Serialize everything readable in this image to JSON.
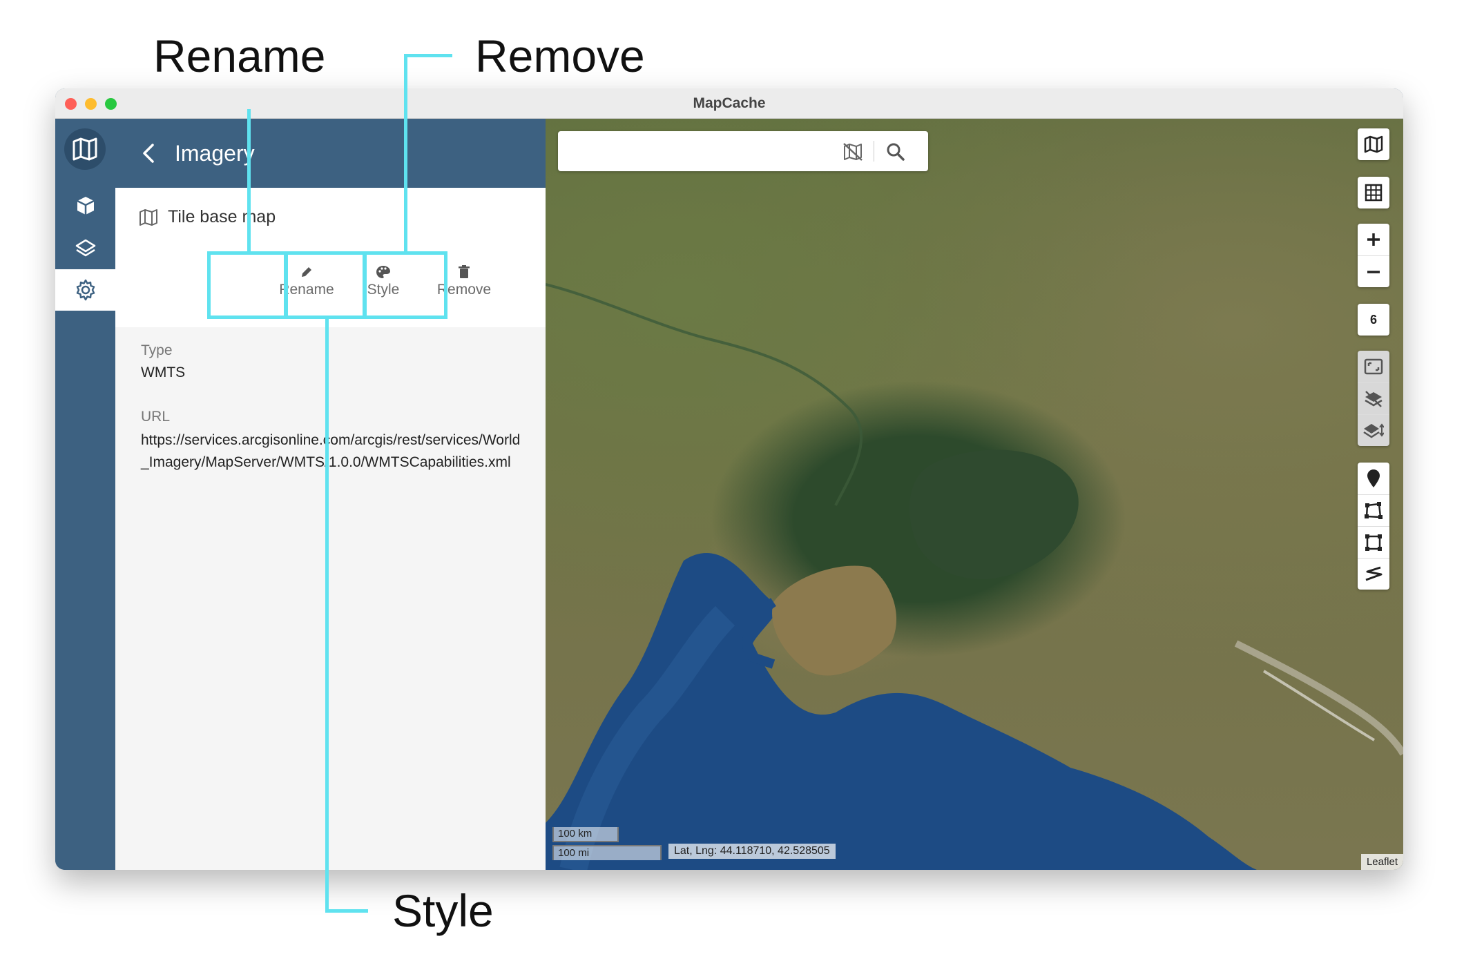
{
  "annotations": {
    "rename": "Rename",
    "remove": "Remove",
    "style": "Style"
  },
  "window": {
    "title": "MapCache"
  },
  "panel": {
    "back_icon": "chevron-left-icon",
    "title": "Imagery",
    "item_name": "Tile base map",
    "actions": {
      "rename": "Rename",
      "style": "Style",
      "remove": "Remove"
    },
    "type_label": "Type",
    "type_value": "WMTS",
    "url_label": "URL",
    "url_value": "https://services.arcgisonline.com/arcgis/rest/services/World_Imagery/MapServer/WMTS/1.0.0/WMTSCapabilities.xml"
  },
  "rail": {
    "items": [
      "map-logo-icon",
      "cube-icon",
      "layers-icon",
      "settings-icon"
    ],
    "active": "settings-icon"
  },
  "map": {
    "search_placeholder": "",
    "zoom_level": "6",
    "scale_km": "100 km",
    "scale_mi": "100 mi",
    "coordinates": "Lat, Lng: 44.118710, 42.528505",
    "attribution": "Leaflet"
  },
  "colors": {
    "accent": "#3d6181",
    "highlight": "#5fe2ef",
    "sea": "#1f4f86"
  }
}
